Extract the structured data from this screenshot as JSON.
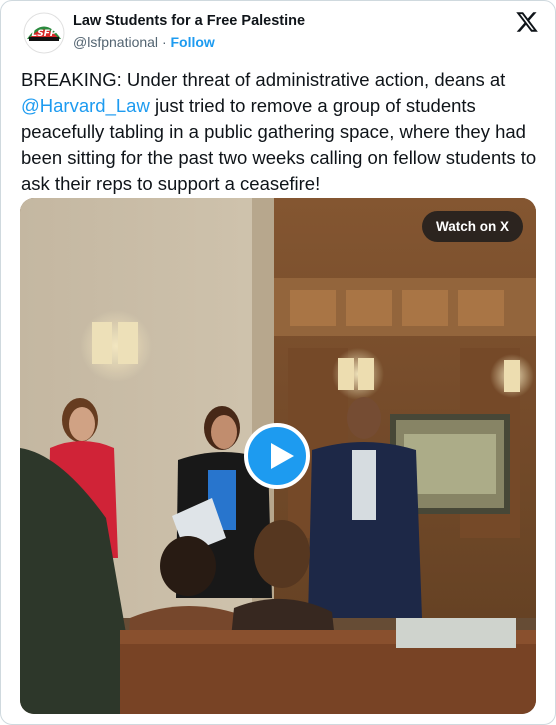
{
  "author": {
    "display_name": "Law Students for a Free Palestine",
    "handle": "@lsfpnational",
    "separator": "·",
    "follow_label": "Follow",
    "avatar_text": "LSFP"
  },
  "brand": {
    "logo_icon": "x-logo-icon"
  },
  "tweet": {
    "text_before": "BREAKING: Under threat of administrative action, deans at ",
    "mention": "@Harvard_Law",
    "text_after": " just tried to remove a group of students peacefully tabling in a public gathering space, where they had been sitting for the past two weeks calling on fellow students to ask their reps to support a ceasefire!"
  },
  "media": {
    "watch_label": "Watch on X",
    "play_icon": "play-icon"
  },
  "colors": {
    "accent": "#1d9bf0",
    "text": "#0f1419",
    "secondary": "#536471"
  }
}
